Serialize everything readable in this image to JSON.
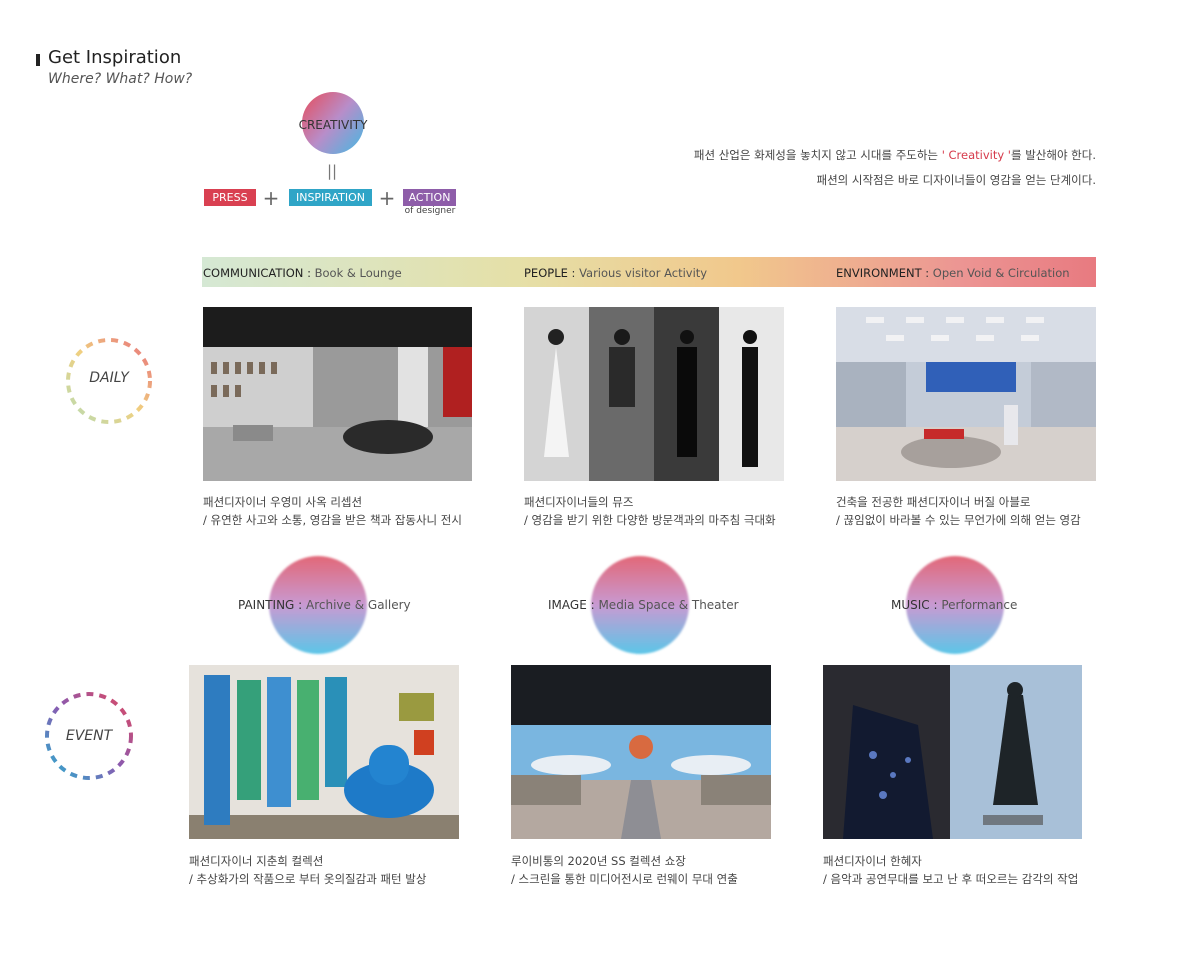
{
  "header": {
    "title": "Get Inspiration",
    "subtitle": "Where? What? How?"
  },
  "formula": {
    "result": "CREATIVITY",
    "equals": "||",
    "terms": [
      "PRESS",
      "INSPIRATION",
      "ACTION"
    ],
    "operator": "+",
    "action_note": "of designer",
    "colors": {
      "press": "#d94051",
      "inspiration": "#2fa5c7",
      "action": "#8e5da9"
    }
  },
  "description": {
    "line1_pre": "패션 산업은 화제성을 놓치지 않고 시대를 주도하는",
    "line1_highlight": "' Creativity '",
    "line1_post": "를 발산해야 한다.",
    "line2": "패션의 시작점은 바로 디자이너들이 영감을 얻는 단계이다."
  },
  "band": [
    {
      "key": "COMMUNICATION",
      "value": "Book & Lounge"
    },
    {
      "key": "PEOPLE",
      "value": "Various visitor Activity"
    },
    {
      "key": "ENVIRONMENT",
      "value": "Open Void & Circulation"
    }
  ],
  "daily": {
    "label": "DAILY",
    "items": [
      {
        "line1": "패션디자이너 우영미 사옥 리셉션",
        "line2": "/ 유연한 사고와 소통, 영감을 받은 책과 잡동사니 전시"
      },
      {
        "line1": "패션디자이너들의 뮤즈",
        "line2": "/ 영감을 받기 위한 다양한 방문객과의 마주침 극대화"
      },
      {
        "line1": "건축을 전공한 패션디자이너 버질 아블로",
        "line2": "/ 끊임없이 바라볼 수 있는 무언가에 의해 얻는 영감"
      }
    ]
  },
  "event": {
    "label": "EVENT",
    "categories": [
      {
        "key": "PAINTING",
        "value": "Archive & Gallery"
      },
      {
        "key": "IMAGE",
        "value": "Media Space & Theater"
      },
      {
        "key": "MUSIC",
        "value": "Performance"
      }
    ],
    "items": [
      {
        "line1": "패션디자이너 지춘희 컬렉션",
        "line2": "/ 추상화가의 작품으로 부터 옷의질감과 패턴 발상"
      },
      {
        "line1": "루이비통의 2020년 SS 컬렉션 쇼장",
        "line2": "/ 스크린을 통한 미디어전시로 런웨이 무대 연출"
      },
      {
        "line1": "패션디자이너 한혜자",
        "line2": "/ 음악과 공연무대를 보고 난 후 떠오르는 감각의 작업"
      }
    ]
  }
}
